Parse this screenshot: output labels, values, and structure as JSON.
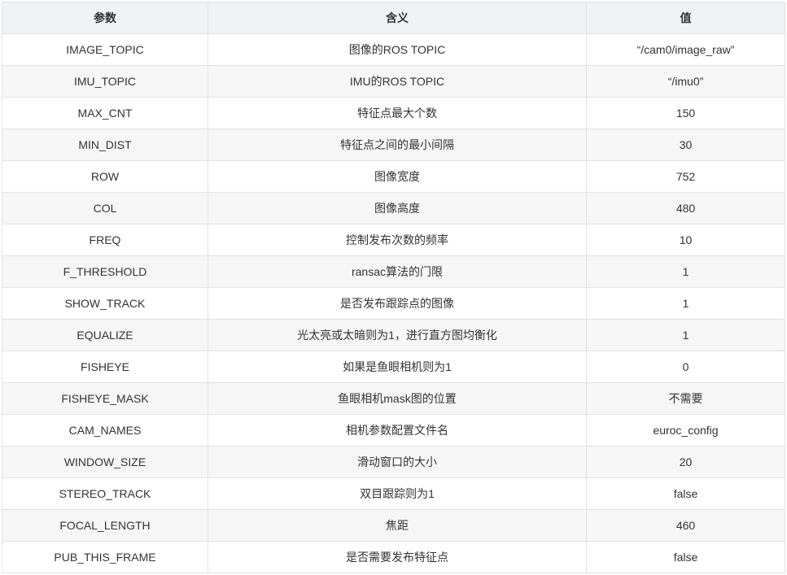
{
  "table": {
    "headers": [
      "参数",
      "含义",
      "值"
    ],
    "rows": [
      {
        "param": "IMAGE_TOPIC",
        "meaning": "图像的ROS TOPIC",
        "value": "“/cam0/image_raw”"
      },
      {
        "param": "IMU_TOPIC",
        "meaning": "IMU的ROS TOPIC",
        "value": "“/imu0”"
      },
      {
        "param": "MAX_CNT",
        "meaning": "特征点最大个数",
        "value": "150"
      },
      {
        "param": "MIN_DIST",
        "meaning": "特征点之间的最小间隔",
        "value": "30"
      },
      {
        "param": "ROW",
        "meaning": "图像宽度",
        "value": "752"
      },
      {
        "param": "COL",
        "meaning": "图像高度",
        "value": "480"
      },
      {
        "param": "FREQ",
        "meaning": "控制发布次数的频率",
        "value": "10"
      },
      {
        "param": "F_THRESHOLD",
        "meaning": "ransac算法的门限",
        "value": "1"
      },
      {
        "param": "SHOW_TRACK",
        "meaning": "是否发布跟踪点的图像",
        "value": "1"
      },
      {
        "param": "EQUALIZE",
        "meaning": "光太亮或太暗则为1，进行直方图均衡化",
        "value": "1"
      },
      {
        "param": "FISHEYE",
        "meaning": "如果是鱼眼相机则为1",
        "value": "0"
      },
      {
        "param": "FISHEYE_MASK",
        "meaning": "鱼眼相机mask图的位置",
        "value": "不需要"
      },
      {
        "param": "CAM_NAMES",
        "meaning": "相机参数配置文件名",
        "value": "euroc_config"
      },
      {
        "param": "WINDOW_SIZE",
        "meaning": "滑动窗口的大小",
        "value": "20"
      },
      {
        "param": "STEREO_TRACK",
        "meaning": "双目跟踪则为1",
        "value": "false"
      },
      {
        "param": "FOCAL_LENGTH",
        "meaning": "焦距",
        "value": "460"
      },
      {
        "param": "PUB_THIS_FRAME",
        "meaning": "是否需要发布特征点",
        "value": "false"
      }
    ]
  }
}
